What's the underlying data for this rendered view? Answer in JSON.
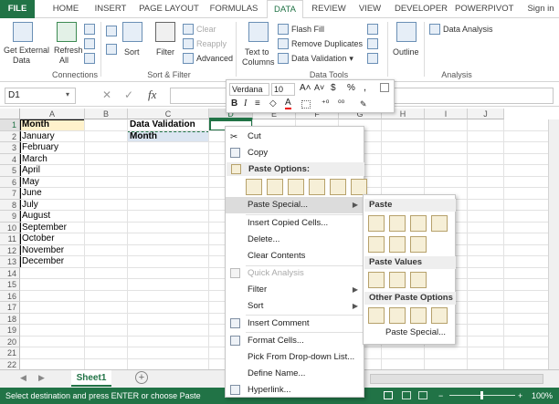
{
  "tabs": [
    {
      "label": "FILE"
    },
    {
      "label": "HOME"
    },
    {
      "label": "INSERT"
    },
    {
      "label": "PAGE LAYOUT"
    },
    {
      "label": "FORMULAS"
    },
    {
      "label": "DATA"
    },
    {
      "label": "REVIEW"
    },
    {
      "label": "VIEW"
    },
    {
      "label": "DEVELOPER"
    },
    {
      "label": "POWERPIVOT"
    },
    {
      "label": "Sign in"
    }
  ],
  "ribbon": {
    "get_external_data": "Get External",
    "get_external_data2": "Data",
    "refresh": "Refresh",
    "refresh_all": "All",
    "connections_group": "Connections",
    "sort": "Sort",
    "filter": "Filter",
    "clear": "Clear",
    "reapply": "Reapply",
    "advanced": "Advanced",
    "sort_filter_group": "Sort & Filter",
    "text_to": "Text to",
    "columns": "Columns",
    "flash_fill": "Flash Fill",
    "remove_duplicates": "Remove Duplicates",
    "data_validation": "Data Validation",
    "data_tools_group": "Data Tools",
    "outline": "Outline",
    "data_analysis": "Data Analysis",
    "analysis_group": "Analysis"
  },
  "formula_bar": {
    "name_box": "D1",
    "fx": "fx"
  },
  "columns": [
    "A",
    "B",
    "C",
    "D",
    "E",
    "F",
    "G",
    "H",
    "I",
    "J"
  ],
  "rows": [
    "1",
    "2",
    "3",
    "4",
    "5",
    "6",
    "7",
    "8",
    "9",
    "10",
    "11",
    "12",
    "13",
    "14",
    "15",
    "16",
    "17",
    "18",
    "19",
    "20",
    "21",
    "22"
  ],
  "cells": {
    "a1": "Month",
    "months": [
      "January",
      "February",
      "March",
      "April",
      "May",
      "June",
      "July",
      "August",
      "September",
      "October",
      "November",
      "December"
    ],
    "c1": "Data Validation",
    "c2": "Month"
  },
  "mini_toolbar": {
    "font": "Verdana",
    "size": "10",
    "currency": "$",
    "percent": "%",
    "comma": ","
  },
  "context_menu": {
    "cut": "Cut",
    "copy": "Copy",
    "paste_options": "Paste Options:",
    "paste_special": "Paste Special...",
    "insert_copied": "Insert Copied Cells...",
    "delete": "Delete...",
    "clear_contents": "Clear Contents",
    "quick_analysis": "Quick Analysis",
    "filter": "Filter",
    "sort": "Sort",
    "insert_comment": "Insert Comment",
    "format_cells": "Format Cells...",
    "pick_dropdown": "Pick From Drop-down List...",
    "define_name": "Define Name...",
    "hyperlink": "Hyperlink..."
  },
  "submenu": {
    "paste": "Paste",
    "paste_values": "Paste Values",
    "other_paste": "Other Paste Options",
    "paste_special": "Paste Special..."
  },
  "sheet_tab": "Sheet1",
  "status": {
    "text": "Select destination and press ENTER or choose Paste",
    "zoom": "100%"
  },
  "colors": {
    "accent": "#217346"
  }
}
